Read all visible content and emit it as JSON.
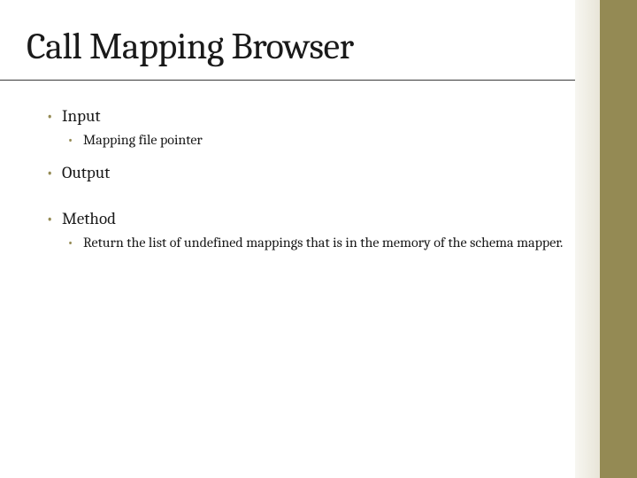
{
  "slide": {
    "title": "Call Mapping Browser",
    "bullets": [
      {
        "level": 1,
        "text": "Input"
      },
      {
        "level": 2,
        "text": "Mapping file pointer"
      },
      {
        "level": 1,
        "text": "Output"
      },
      {
        "level": 1,
        "text": "Method"
      },
      {
        "level": 2,
        "text": "Return the list of undefined mappings that is in the memory of the schema mapper."
      }
    ]
  },
  "theme": {
    "accent": "#948a54"
  }
}
